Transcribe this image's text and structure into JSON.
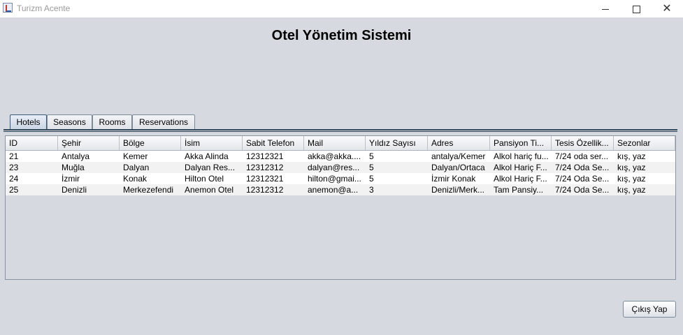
{
  "window": {
    "title": "Turizm Acente",
    "minimize_glyph": "",
    "maximize_glyph": "",
    "close_glyph": "✕"
  },
  "heading": "Otel Yönetim Sistemi",
  "tabs": [
    {
      "label": "Hotels",
      "active": true
    },
    {
      "label": "Seasons",
      "active": false
    },
    {
      "label": "Rooms",
      "active": false
    },
    {
      "label": "Reservations",
      "active": false
    }
  ],
  "table": {
    "columns": [
      "ID",
      "Şehir",
      "Bölge",
      "İsim",
      "Sabit Telefon",
      "Mail",
      "Yıldız Sayısı",
      "Adres",
      "Pansiyon Ti...",
      "Tesis Özellik...",
      "Sezonlar"
    ],
    "rows": [
      [
        "21",
        "Antalya",
        "Kemer",
        "Akka Alinda",
        "12312321",
        "akka@akka....",
        "5",
        "antalya/Kemer",
        "Alkol hariç fu...",
        "7/24 oda ser...",
        "kış, yaz"
      ],
      [
        "23",
        "Muğla",
        "Dalyan",
        "Dalyan Res...",
        "12312312",
        "dalyan@res...",
        "5",
        "Dalyan/Ortaca",
        "Alkol Hariç F...",
        "7/24 Oda Se...",
        "kış, yaz"
      ],
      [
        "24",
        "İzmir",
        "Konak",
        "Hilton Otel",
        "12312321",
        "hilton@gmai...",
        "5",
        "İzmir Konak",
        "Alkol Hariç F...",
        "7/24 Oda Se...",
        "kış, yaz"
      ],
      [
        "25",
        "Denizli",
        "Merkezefendi",
        "Anemon Otel",
        "12312312",
        "anemon@a...",
        "3",
        "Denizli/Merk...",
        "Tam Pansiy...",
        "7/24 Oda Se...",
        "kış, yaz"
      ]
    ]
  },
  "buttons": {
    "exit_label": "Çıkış Yap"
  }
}
